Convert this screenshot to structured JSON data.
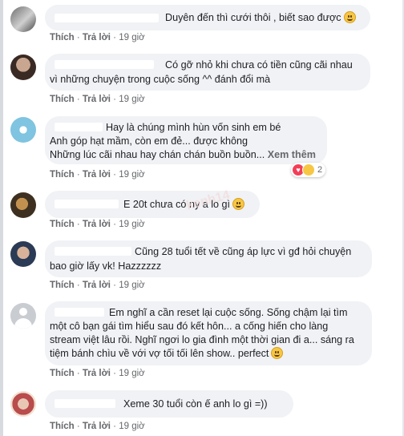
{
  "actions": {
    "like": "Thích",
    "reply": "Trả lời",
    "sep": "·"
  },
  "comments": [
    {
      "lines": [
        "Duyên đến thì cưới thôi , biết sao được"
      ],
      "time": "19 giờ",
      "emoji": "smile-emoji"
    },
    {
      "lines": [
        "Có gỡ nhỏ khi chưa có tiền cũng cãi nhau",
        "vì những chuyện trong cuộc sống ^^ đánh đổi mà"
      ],
      "time": "19 giờ"
    },
    {
      "lines": [
        "Hay là chúng mình hùn vốn sinh em bé",
        "Anh góp hạt mầm, còn em đẻ... được không",
        "Những lúc cãi nhau hay chán chán buồn buồn..."
      ],
      "see_more": "Xem thêm",
      "reaction_count": "2",
      "time": "19 giờ"
    },
    {
      "lines": [
        "E 20t chưa có ny a lo gì"
      ],
      "time": "19 giờ",
      "emoji": "laugh-emoji"
    },
    {
      "lines": [
        "Cũng 28 tuổi tết về cũng áp lực vì gđ hỏi chuyện",
        "bao giờ lấy vk! Hazzzzzz"
      ],
      "time": "19 giờ"
    },
    {
      "lines": [
        "Em nghĩ a cần reset lại cuộc sống. Sống chậm lại tìm",
        "một cô bạn gái tìm hiểu sau đó kết hôn... a cống hiến cho làng",
        "stream việt lâu rồi. Nghĩ ngơi lo gia đình một thời gian đi a... sáng ra",
        "tiệm bánh chìu về với vợ tối tối lên show.. perfect"
      ],
      "time": "19 giờ",
      "emoji": "grin-emoji"
    },
    {
      "lines": [
        "Xeme 30 tuổi còn ế anh lo gì =))"
      ],
      "time": "19 giờ"
    }
  ]
}
